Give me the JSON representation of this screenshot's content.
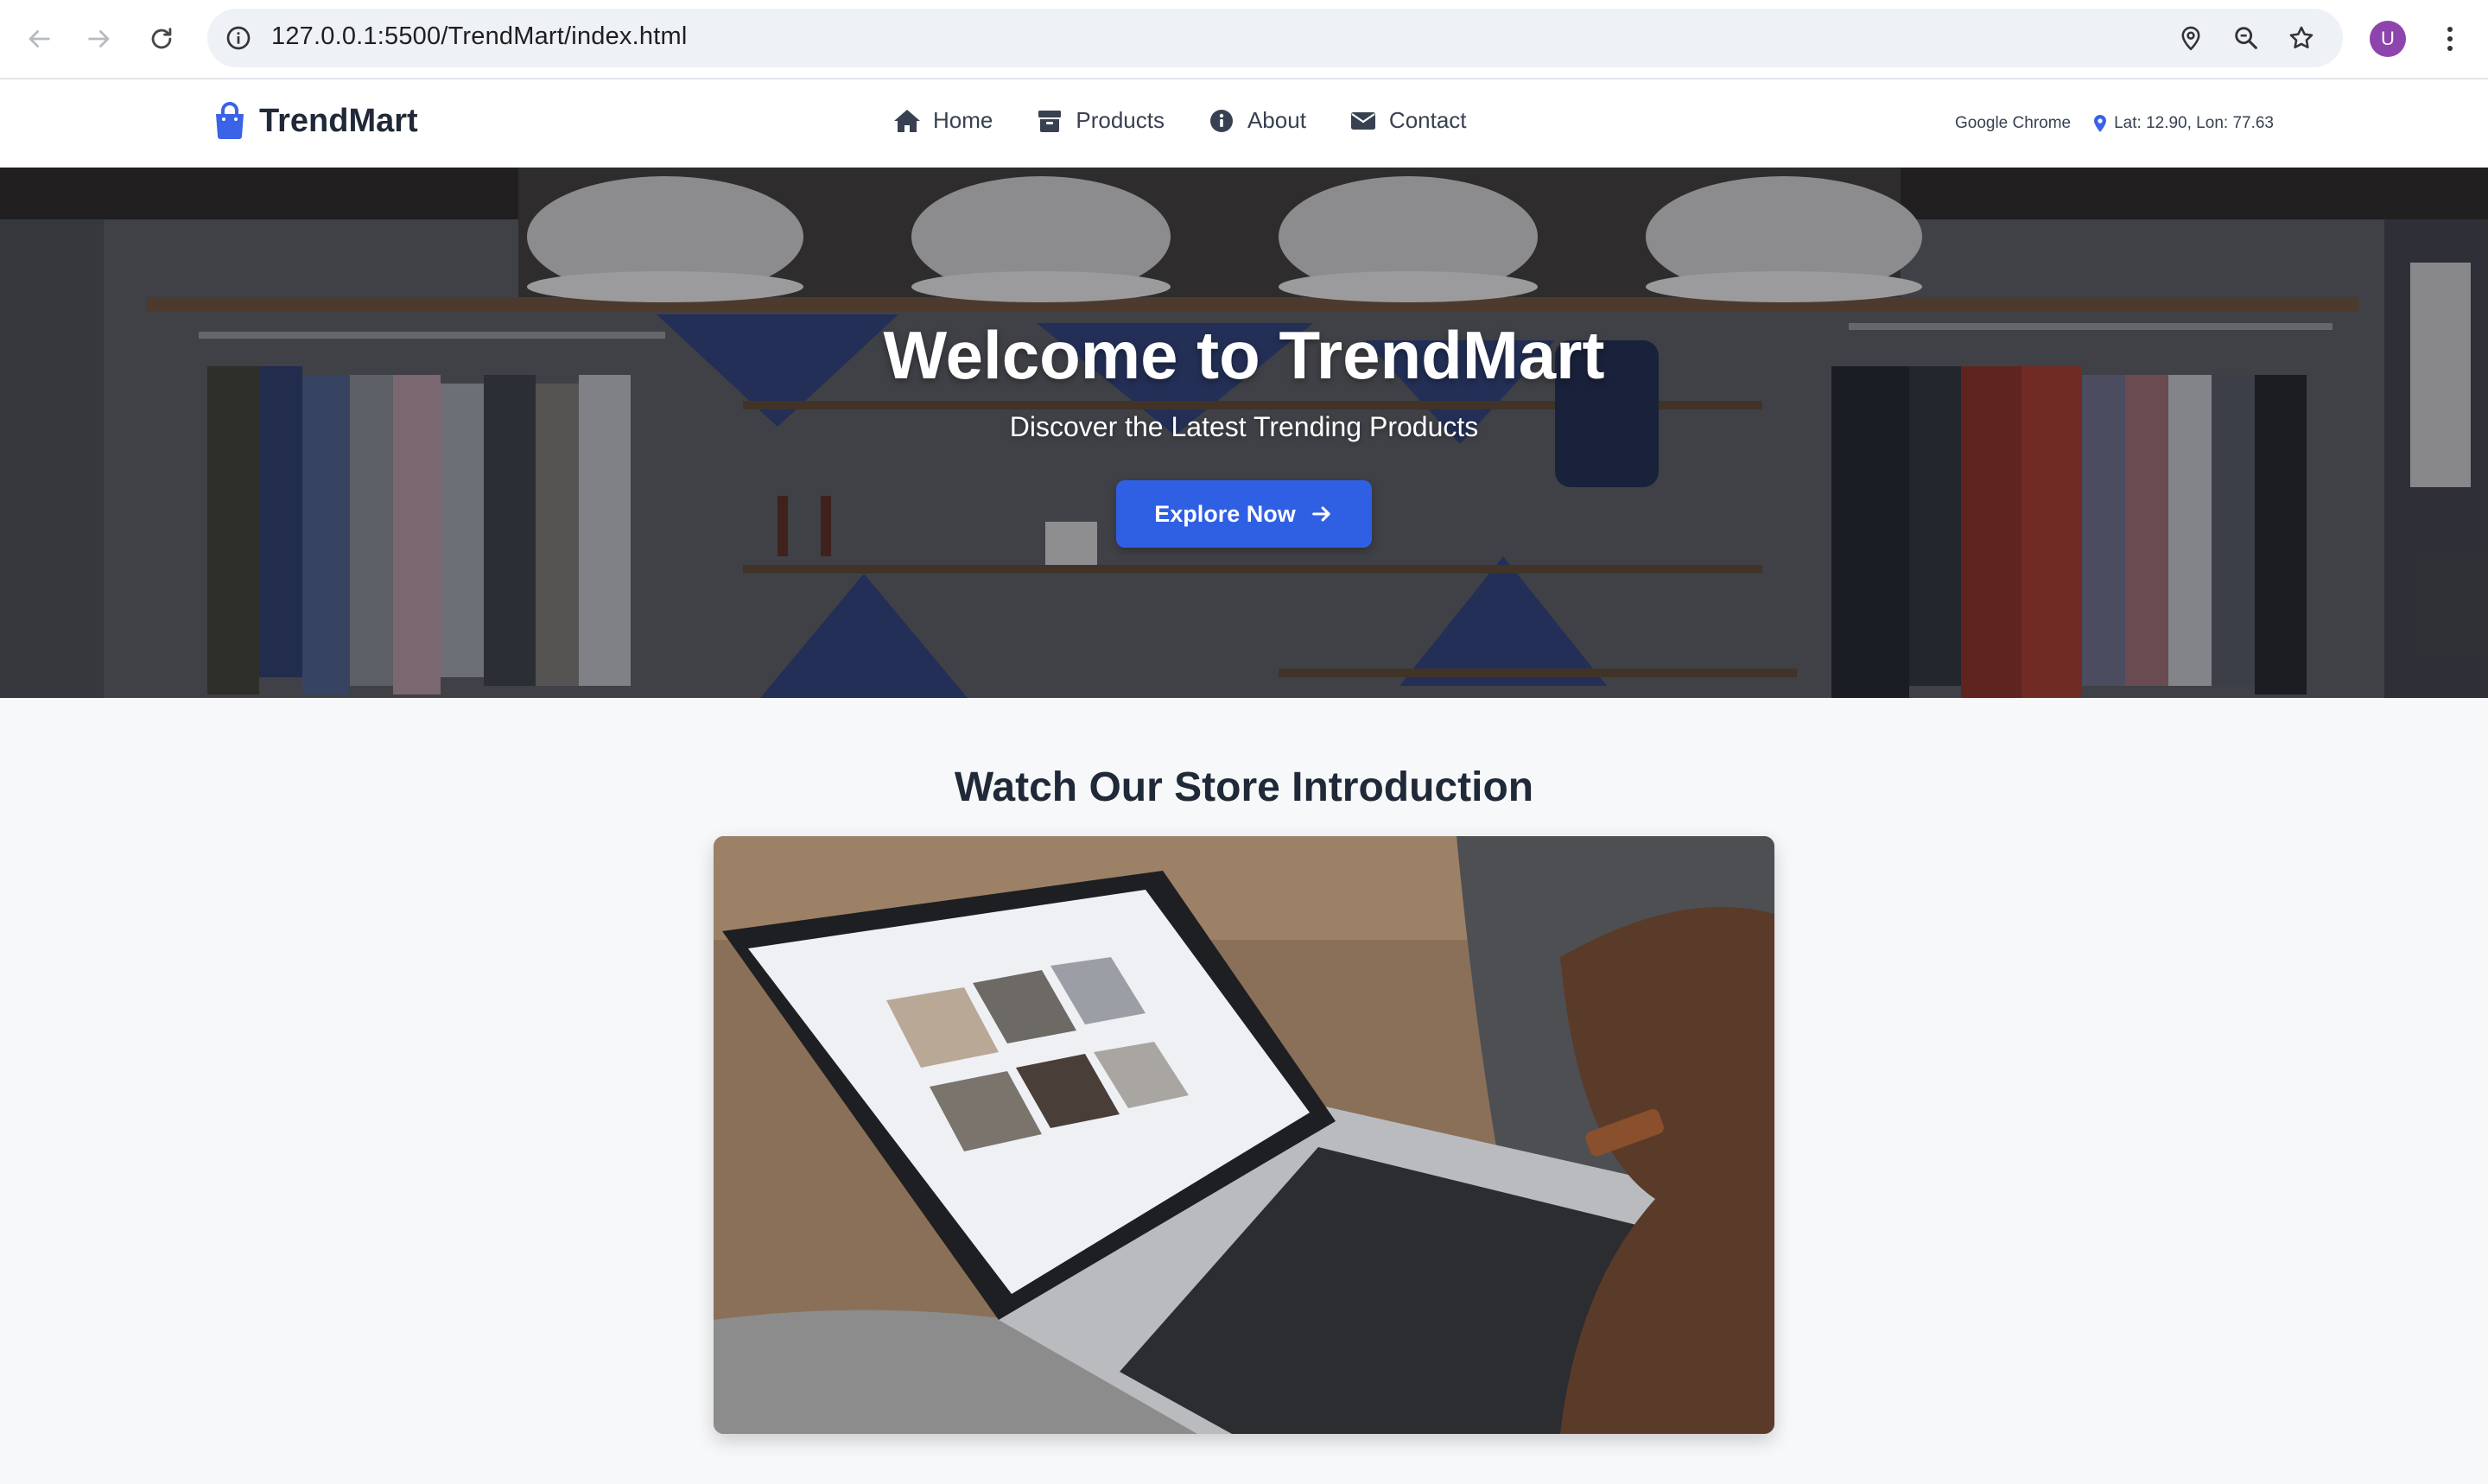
{
  "browser": {
    "url": "127.0.0.1:5500/TrendMart/index.html",
    "profile_initial": "U"
  },
  "nav": {
    "brand": "TrendMart",
    "menu": [
      {
        "label": "Home",
        "icon": "home-icon"
      },
      {
        "label": "Products",
        "icon": "box-icon"
      },
      {
        "label": "About",
        "icon": "info-icon"
      },
      {
        "label": "Contact",
        "icon": "envelope-icon"
      }
    ],
    "browser_name": "Google Chrome",
    "location": "Lat: 12.90, Lon: 77.63"
  },
  "hero": {
    "title": "Welcome to TrendMart",
    "subtitle": "Discover the Latest Trending Products",
    "cta": "Explore Now"
  },
  "video_section": {
    "title": "Watch Our Store Introduction"
  },
  "colors": {
    "accent": "#2f5fe3",
    "brand_icon": "#3b63e8",
    "page_bg": "#f7f8fa"
  }
}
